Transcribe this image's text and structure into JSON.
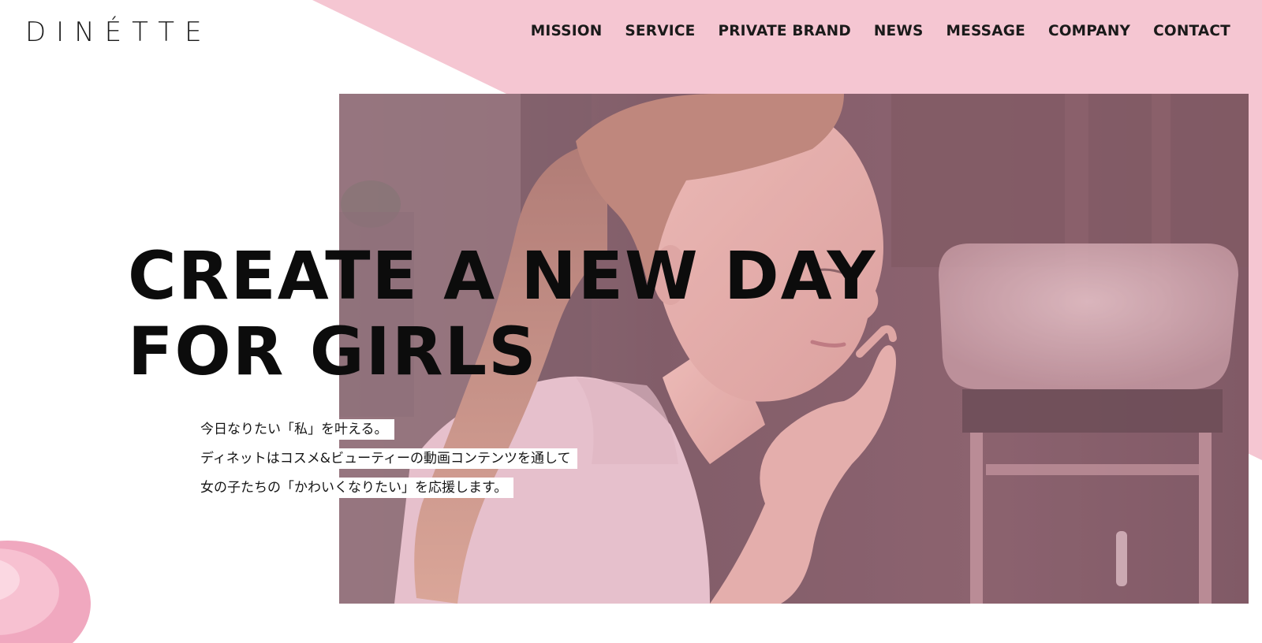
{
  "brand": {
    "logo": "DINÉTTE"
  },
  "nav": {
    "items": [
      "MISSION",
      "SERVICE",
      "PRIVATE BRAND",
      "NEWS",
      "MESSAGE",
      "COMPANY",
      "CONTACT"
    ]
  },
  "hero": {
    "headline_line1": "CREATE A NEW DAY",
    "headline_line2": "FOR GIRLS",
    "copy": [
      "今日なりたい「私」を叶える。",
      "ディネットはコスメ&ビューティーの動画コンテンツを通して",
      "女の子たちの「かわいくなりたい」を応援します。"
    ]
  },
  "colors": {
    "accent_pink": "#f5c6d2",
    "text_dark": "#111111",
    "image_tint": "#e7a9bd"
  }
}
